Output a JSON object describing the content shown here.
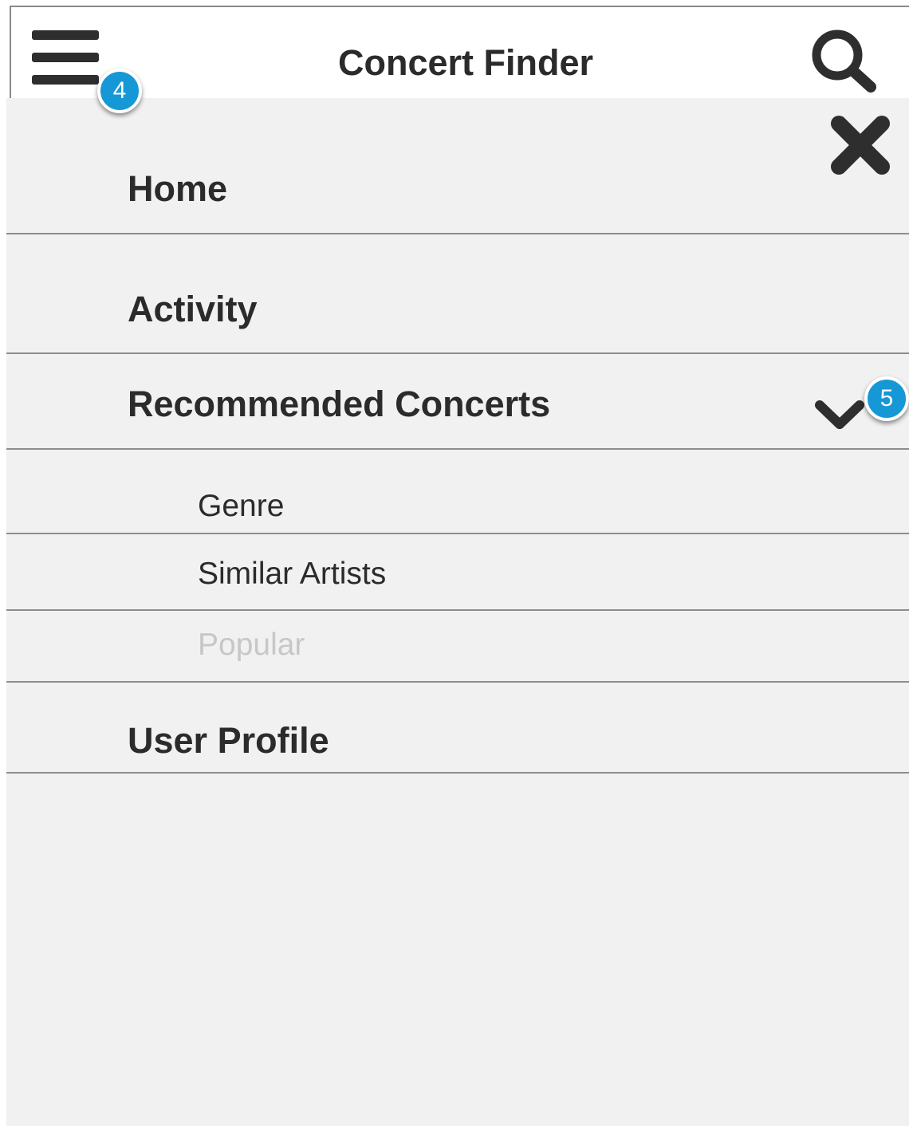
{
  "app_bar": {
    "title": "Concert Finder",
    "menu_icon": "hamburger-icon",
    "search_icon": "search-icon"
  },
  "drawer": {
    "close_icon": "close-icon",
    "items": [
      {
        "label": "Home"
      },
      {
        "label": "Activity"
      },
      {
        "label": "Recommended Concerts",
        "expanded": true,
        "expand_icon": "chevron-down-icon"
      },
      {
        "label": "User Profile"
      }
    ],
    "sub_items": [
      {
        "label": "Genre",
        "enabled": true
      },
      {
        "label": "Similar Artists",
        "enabled": true
      },
      {
        "label": "Popular",
        "enabled": false
      }
    ]
  },
  "annotations": [
    {
      "number": "4",
      "target": "menu-button"
    },
    {
      "number": "5",
      "target": "expand-chevron"
    }
  ],
  "colors": {
    "drawer_background": "#f1f1f1",
    "text": "#2b2b2b",
    "disabled_text": "#c7c7c7",
    "divider": "#8d8d8d",
    "badge": "#1798d6"
  }
}
